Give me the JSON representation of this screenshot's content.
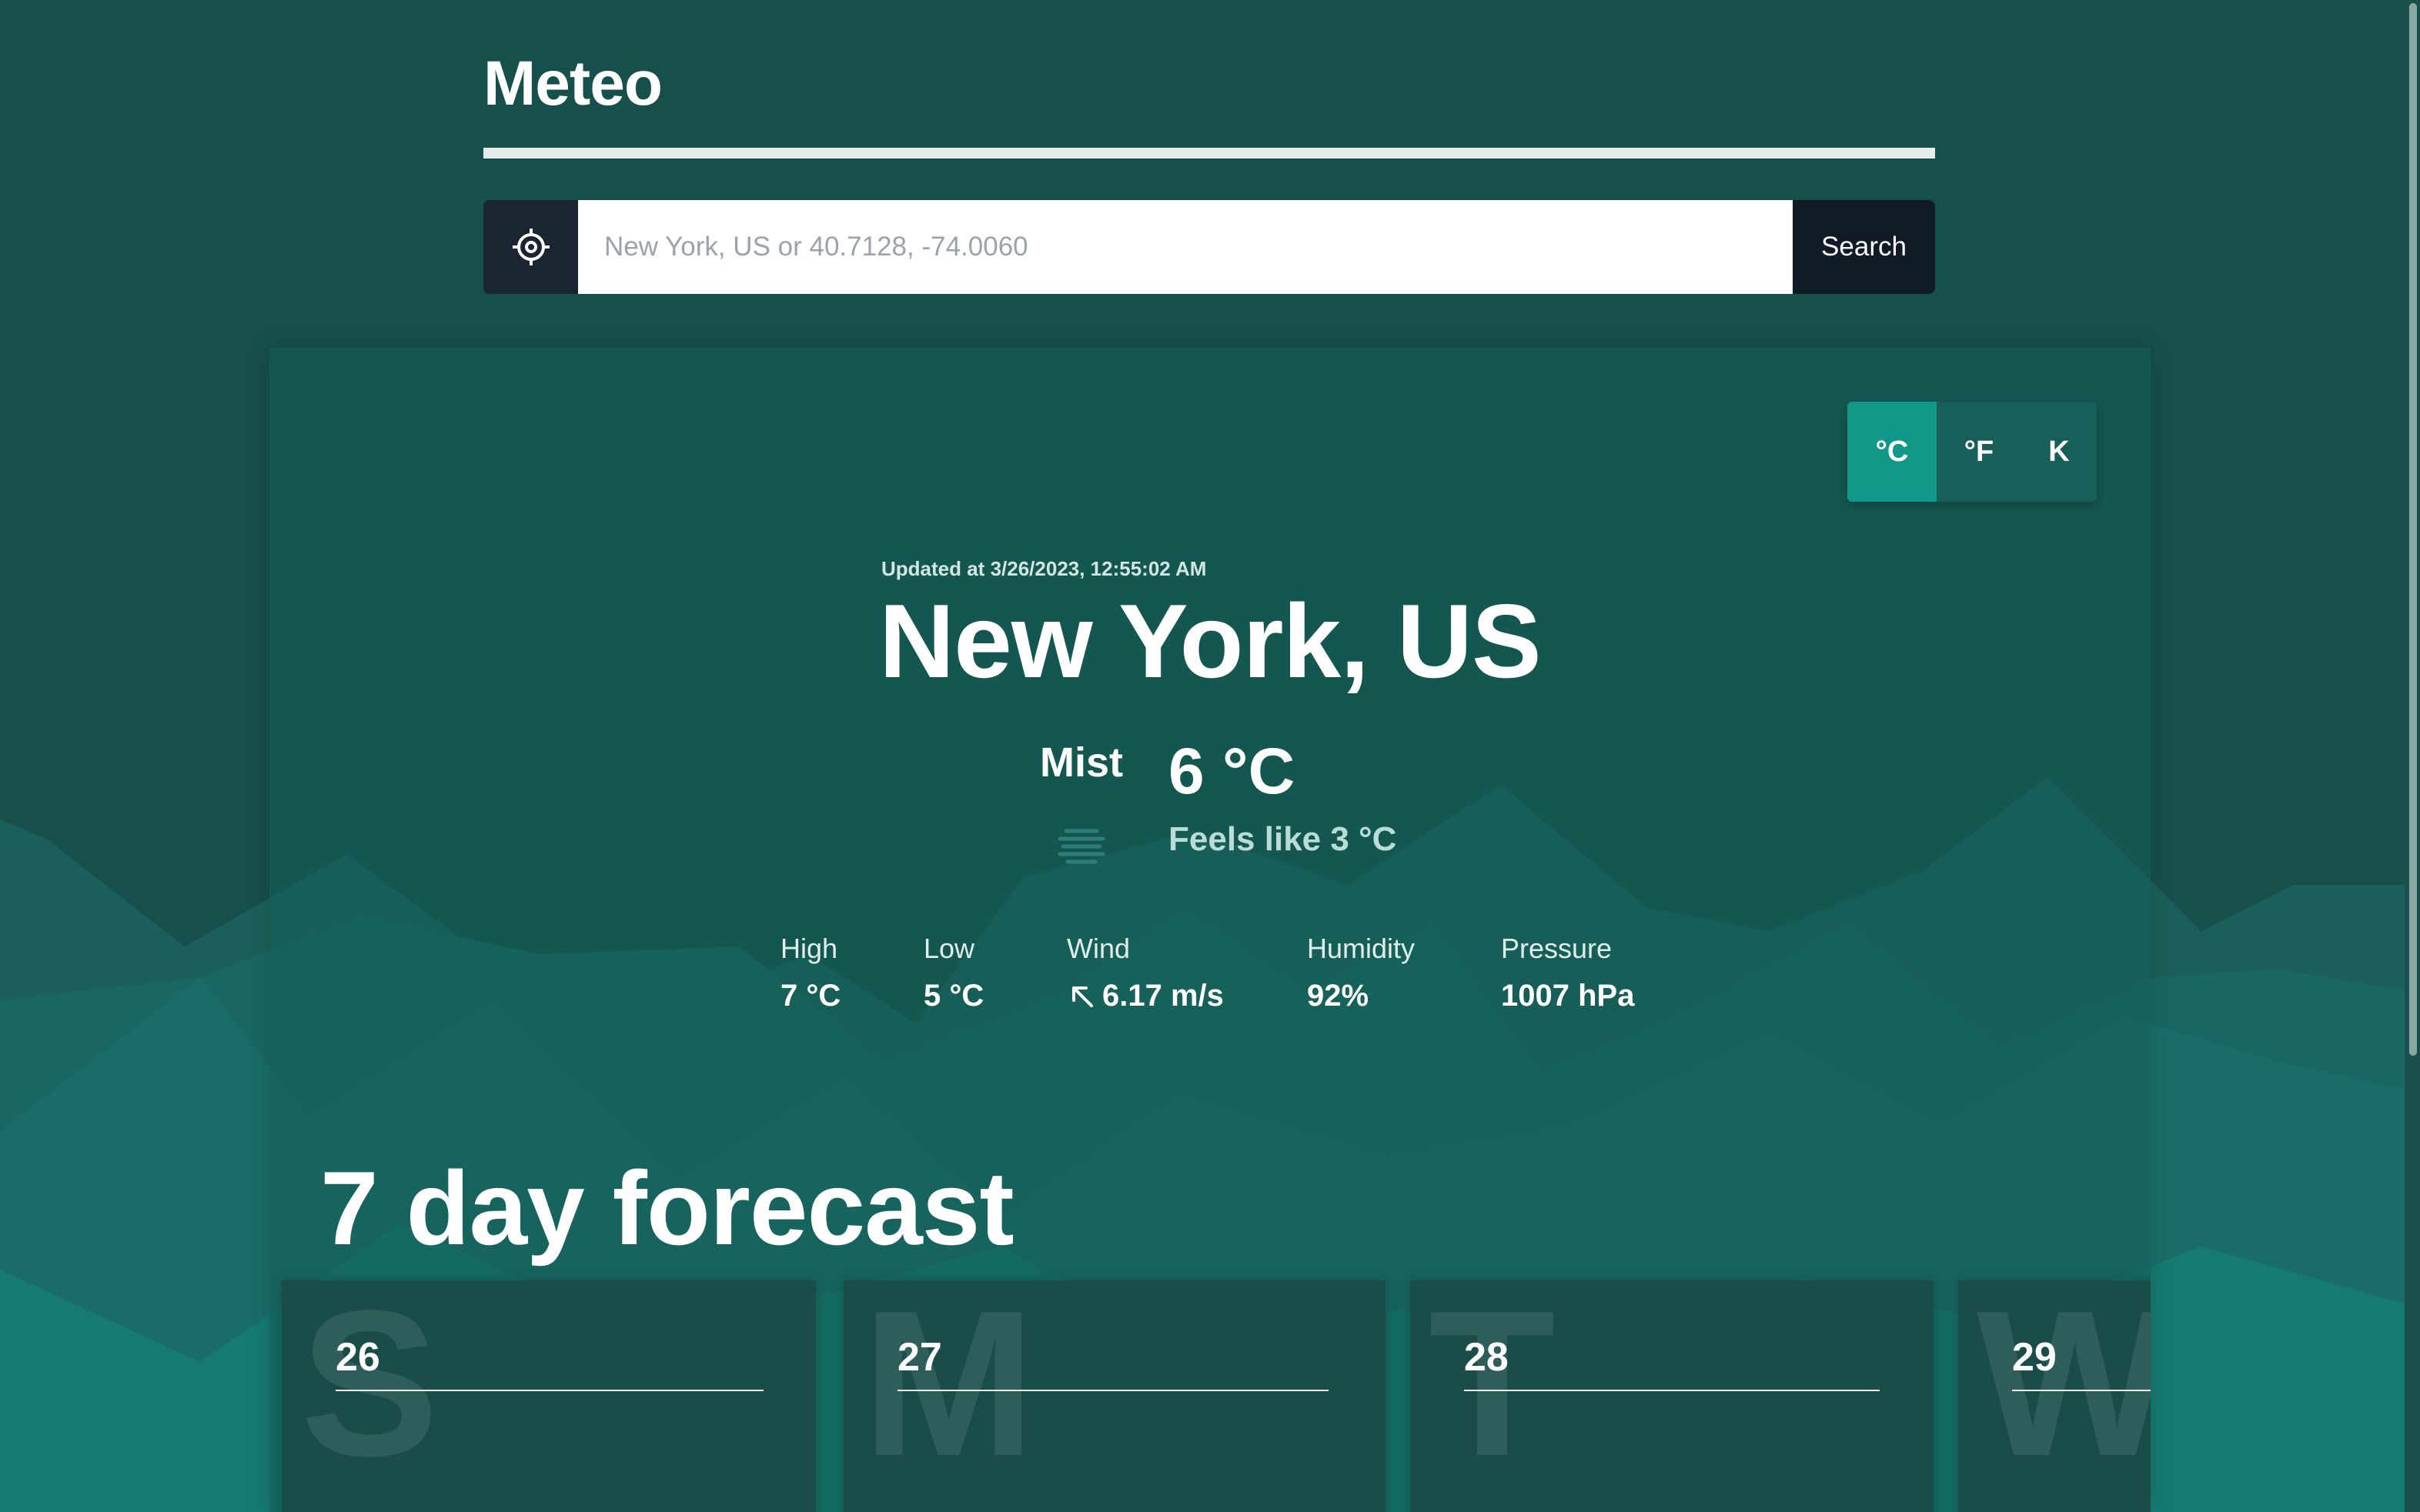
{
  "header": {
    "brand": "Meteo"
  },
  "search": {
    "placeholder": "New York, US or 40.7128, -74.0060",
    "button_label": "Search",
    "locate_icon": "crosshair-icon"
  },
  "units": {
    "celsius": "°C",
    "fahrenheit": "°F",
    "kelvin": "K",
    "selected": "°C"
  },
  "current": {
    "updated": "Updated at 3/26/2023, 12:55:02 AM",
    "location": "New York, US",
    "condition": "Mist",
    "condition_icon": "mist-icon",
    "temperature": "6 °C",
    "feels_like": "Feels like 3 °C",
    "stats": [
      {
        "label": "High",
        "value": "7 °C"
      },
      {
        "label": "Low",
        "value": "5 °C"
      },
      {
        "label": "Wind",
        "value": "6.17 m/s",
        "icon": "arrow-up-left-icon"
      },
      {
        "label": "Humidity",
        "value": "92%"
      },
      {
        "label": "Pressure",
        "value": "1007 hPa"
      }
    ]
  },
  "forecast": {
    "title": "7 day forecast",
    "days": [
      {
        "letter": "S",
        "date": "26"
      },
      {
        "letter": "M",
        "date": "27"
      },
      {
        "letter": "T",
        "date": "28"
      },
      {
        "letter": "W",
        "date": "29"
      }
    ]
  },
  "colors": {
    "page_bg": "#164f4b",
    "accent": "#119888",
    "card_bg": "#1a4d4a",
    "dark": "#111a27"
  }
}
